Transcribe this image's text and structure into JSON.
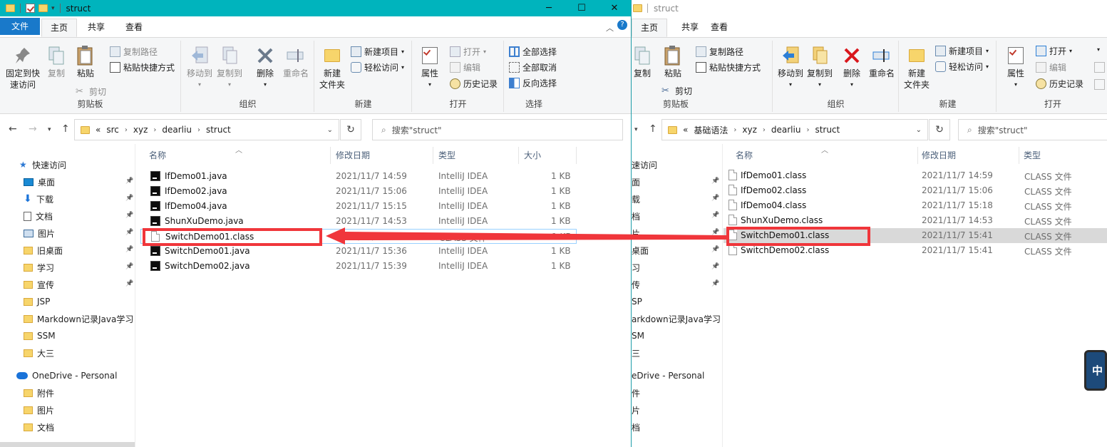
{
  "left_window": {
    "title": "struct",
    "tabs": [
      "文件",
      "主页",
      "共享",
      "查看"
    ],
    "ribbon": {
      "clipboard": {
        "pin": "固定到快速访问",
        "pin_l1": "固定到快",
        "pin_l2": "速访问",
        "copy": "复制",
        "paste": "粘贴",
        "copy_path": "复制路径",
        "paste_shortcut": "粘贴快捷方式",
        "cut": "剪切",
        "label": "剪贴板"
      },
      "organize": {
        "move_to": "移动到",
        "copy_to": "复制到",
        "delete": "删除",
        "rename": "重命名",
        "label": "组织"
      },
      "new": {
        "new_folder_l1": "新建",
        "new_folder_l2": "文件夹",
        "new_item": "新建项目",
        "easy_access": "轻松访问",
        "label": "新建"
      },
      "open": {
        "properties": "属性",
        "open": "打开",
        "edit": "编辑",
        "history": "历史记录",
        "label": "打开"
      },
      "select": {
        "select_all": "全部选择",
        "select_none": "全部取消",
        "invert": "反向选择",
        "label": "选择"
      }
    },
    "address": {
      "prefix": "«",
      "crumbs": [
        "src",
        "xyz",
        "dearliu",
        "struct"
      ]
    },
    "search_placeholder": "搜索\"struct\"",
    "nav": {
      "quick_access": "快速访问",
      "items": [
        "桌面",
        "下载",
        "文档",
        "图片",
        "旧桌面",
        "学习",
        "宣传",
        "JSP",
        "Markdown记录Java学习",
        "SSM",
        "大三"
      ],
      "onedrive": "OneDrive - Personal",
      "onedrive_items": [
        "附件",
        "图片",
        "文档"
      ]
    },
    "columns": [
      "名称",
      "修改日期",
      "类型",
      "大小"
    ],
    "files": [
      {
        "name": "IfDemo01.java",
        "date": "2021/11/7 14:59",
        "type": "IntelliJ IDEA",
        "size": "1 KB"
      },
      {
        "name": "IfDemo02.java",
        "date": "2021/11/7 15:06",
        "type": "IntelliJ IDEA",
        "size": "1 KB"
      },
      {
        "name": "IfDemo04.java",
        "date": "2021/11/7 15:15",
        "type": "IntelliJ IDEA",
        "size": "1 KB"
      },
      {
        "name": "ShunXuDemo.java",
        "date": "2021/11/7 14:53",
        "type": "IntelliJ IDEA",
        "size": "1 KB"
      },
      {
        "name": "SwitchDemo01.class",
        "date": "2021/11/7 15:41",
        "type": "CLASS 文件",
        "size": "1 KB"
      },
      {
        "name": "SwitchDemo01.java",
        "date": "2021/11/7 15:36",
        "type": "IntelliJ IDEA",
        "size": "1 KB"
      },
      {
        "name": "SwitchDemo02.java",
        "date": "2021/11/7 15:39",
        "type": "IntelliJ IDEA",
        "size": "1 KB"
      }
    ]
  },
  "right_window": {
    "title": "struct",
    "tabs": [
      "主页",
      "共享",
      "查看"
    ],
    "ribbon": {
      "clipboard": {
        "copy": "复制",
        "paste": "粘贴",
        "copy_path": "复制路径",
        "paste_shortcut": "粘贴快捷方式",
        "cut": "剪切",
        "label": "剪贴板"
      },
      "organize": {
        "move_to": "移动到",
        "copy_to": "复制到",
        "delete": "删除",
        "rename": "重命名",
        "label": "组织"
      },
      "new": {
        "new_folder_l1": "新建",
        "new_folder_l2": "文件夹",
        "new_item": "新建项目",
        "easy_access": "轻松访问",
        "label": "新建"
      },
      "open": {
        "properties": "属性",
        "open": "打开",
        "edit": "编辑",
        "history": "历史记录",
        "label": "打开"
      }
    },
    "address": {
      "prefix": "«",
      "crumbs": [
        "基础语法",
        "xyz",
        "dearliu",
        "struct"
      ]
    },
    "search_placeholder": "搜索\"struct\"",
    "nav": {
      "items": [
        "速访问",
        "面",
        "载",
        "档",
        "片",
        "桌面",
        "习",
        "传",
        "SP",
        "arkdown记录Java学习",
        "SM",
        "三",
        "eDrive - Personal",
        "件",
        "片",
        "档"
      ]
    },
    "columns": [
      "名称",
      "修改日期",
      "类型"
    ],
    "files": [
      {
        "name": "IfDemo01.class",
        "date": "2021/11/7 14:59",
        "type": "CLASS 文件"
      },
      {
        "name": "IfDemo02.class",
        "date": "2021/11/7 15:06",
        "type": "CLASS 文件"
      },
      {
        "name": "IfDemo04.class",
        "date": "2021/11/7 15:18",
        "type": "CLASS 文件"
      },
      {
        "name": "ShunXuDemo.class",
        "date": "2021/11/7 14:53",
        "type": "CLASS 文件"
      },
      {
        "name": "SwitchDemo01.class",
        "date": "2021/11/7 15:41",
        "type": "CLASS 文件"
      },
      {
        "name": "SwitchDemo02.class",
        "date": "2021/11/7 15:41",
        "type": "CLASS 文件"
      }
    ]
  },
  "ime_indicator": "中",
  "colors": {
    "title_bar": "#00b4bd",
    "file_tab": "#1979ca",
    "annotation": "#f0363b"
  }
}
